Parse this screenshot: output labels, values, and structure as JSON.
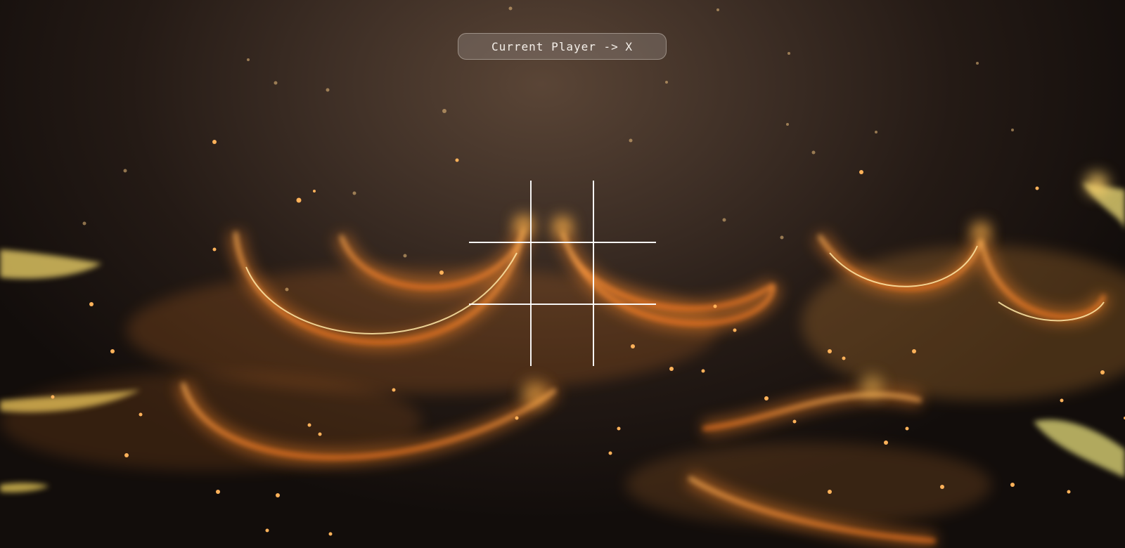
{
  "status": {
    "label": "Current Player ->",
    "current_player": "X"
  },
  "board": {
    "cells": [
      "",
      "",
      "",
      "",
      "",
      "",
      "",
      "",
      ""
    ]
  },
  "colors": {
    "background_dark": "#140f0c",
    "background_glow": "#5a4536",
    "flame_orange": "#ff9a3c",
    "flame_yellow": "#ffe36a",
    "grid_line": "#ffffff",
    "pill_text": "#f4efe9"
  }
}
